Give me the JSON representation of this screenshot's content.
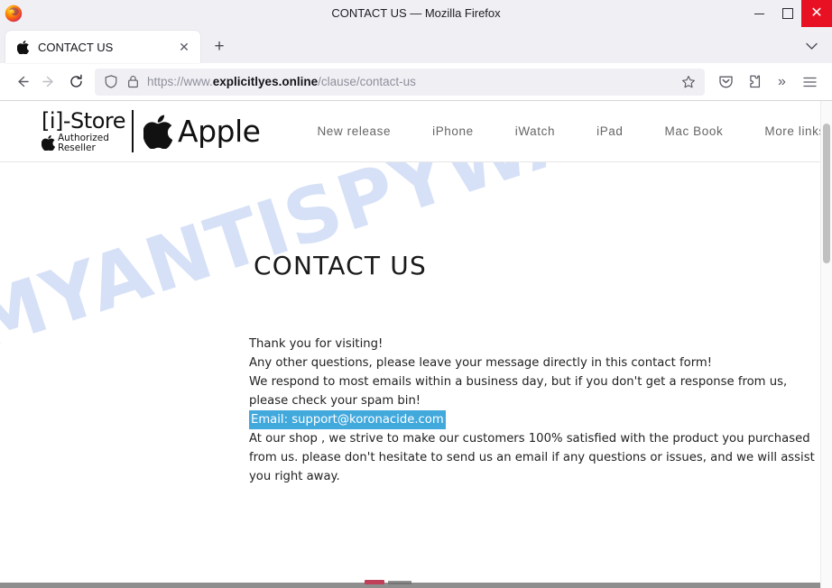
{
  "window": {
    "title": "CONTACT US — Mozilla Firefox",
    "app_icon": "firefox-icon",
    "minimize_label": "Minimize",
    "maximize_label": "Maximize",
    "close_label": "Close",
    "close_glyph": "✕",
    "close_color": "#e81123"
  },
  "tabs": {
    "items": [
      {
        "title": "CONTACT US",
        "favicon": "apple-icon",
        "close_glyph": "✕",
        "active": true
      }
    ],
    "new_tab_glyph": "+",
    "list_all_tabs_glyph": "⌄"
  },
  "toolbar": {
    "back_glyph": "←",
    "forward_glyph": "→",
    "reload_glyph": "⟳",
    "shield_icon": "tracking-protection-shield-icon",
    "lock_icon": "padlock-icon",
    "url_prefix": "https://www.",
    "url_host": "explicitlyes.online",
    "url_path": "/clause/contact-us",
    "bookmark_glyph": "☆",
    "pocket_icon": "save-to-pocket-icon",
    "extensions_icon": "extensions-puzzle-icon",
    "overflow_glyph": "»",
    "menu_glyph": "☰"
  },
  "site": {
    "brand": {
      "istore_word": "[i]-Store",
      "reseller_line1": "Authorized",
      "reseller_line2": "Reseller",
      "apple_word": "Apple"
    },
    "nav": [
      {
        "label": "New release"
      },
      {
        "label": "iPhone"
      },
      {
        "label": "iWatch"
      },
      {
        "label": "iPad"
      },
      {
        "label": "Mac Book"
      },
      {
        "label": "More links"
      }
    ],
    "watermark": "MYANTISPYWARE.COM",
    "watermark_color": "#d6e1f7",
    "page_title": "CONTACT US",
    "paragraphs": {
      "line1": "Thank you for visiting!",
      "line2": "Any other questions, please leave your message directly in this contact form!",
      "line3": "We respond to most emails within a business day, but if you don't get a response from us, please check your spam bin!",
      "email_line": "Email: support@koronacide.com",
      "email_highlight_color": "#42a9dd",
      "line4": "At our shop , we strive to make our customers 100% satisfied with the product you purchased from us. please don't hesitate to send us an email if any questions or issues, and we will assist you right away."
    }
  }
}
